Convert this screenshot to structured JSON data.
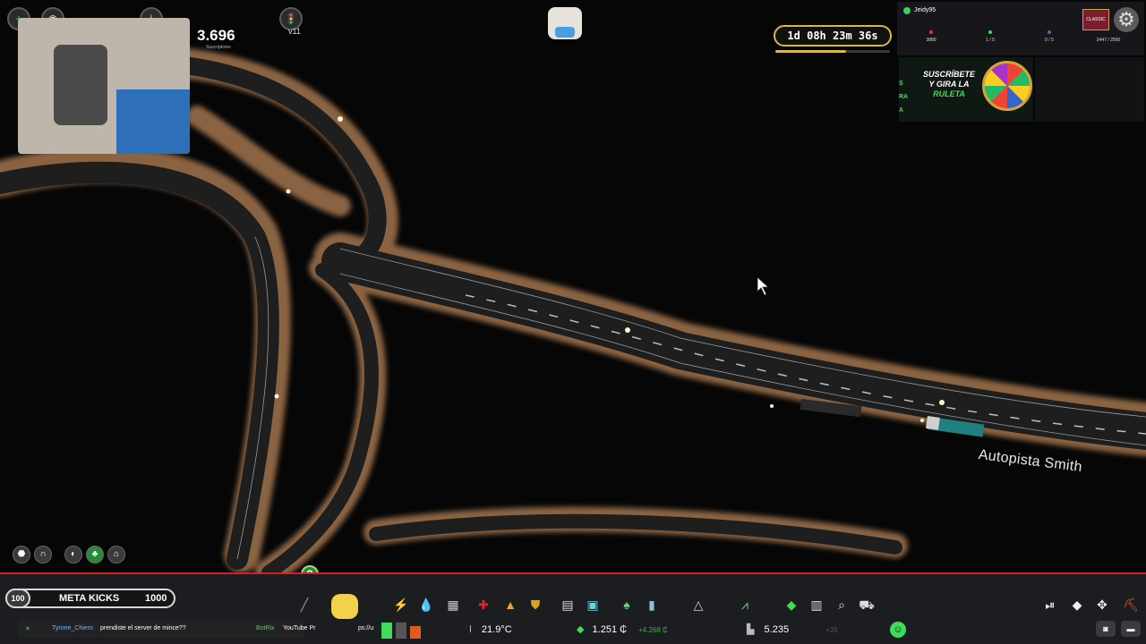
{
  "stream": {
    "subs_count": "3.696",
    "subs_label": "Suscriptores",
    "traffic_label": "v11",
    "timer": "1d 08h 23m 36s",
    "timer_progress": 0.62,
    "streamer": "Jeidy95",
    "stats": [
      "3880",
      "1 / 5",
      "0 / 5",
      "2447 / 2500"
    ],
    "classic_label": "CLASSIC",
    "ruleta_line1": "SUSCRÍBETE",
    "ruleta_line2": "Y GIRA LA",
    "ruleta_line3": "RULETA",
    "side_letters": [
      "S",
      "RA",
      "A"
    ]
  },
  "map": {
    "road_label": "Autopista Smith"
  },
  "icons": {
    "add": "plus-icon",
    "gear": "gear-icon",
    "help": "question-icon",
    "cursor": "mouse-cursor-icon"
  },
  "bottom": {
    "kicks_badge": "100",
    "kicks_title": "META KICKS",
    "kicks_max": "1000",
    "chat_user": "Tyrone_Chiero",
    "chat_msg": "prendiste el server de mince??",
    "chat_bot": "BotRix",
    "chat_promo": "YouTube Pr",
    "chat_extra": "ps://u",
    "temperature": "21.9°C",
    "money": "1.251 ₵",
    "money_delta": "+4.268 ₵",
    "population": "5.235",
    "population_delta": "+35",
    "toolbar_icons": [
      "road-icon",
      "mascot-icon",
      "electricity-icon",
      "water-icon",
      "fence-icon",
      "health-icon",
      "education-icon",
      "police-icon",
      "book-icon",
      "transport-icon",
      "park-icon",
      "landmark-icon",
      "triangle-icon",
      "terrain-icon",
      "money-icon",
      "clipboard-icon",
      "search-icon",
      "vehicle-icon"
    ],
    "right_icons": [
      "play-pause-icon",
      "eraser-icon",
      "move-icon",
      "bulldoze-icon"
    ]
  },
  "colors": {
    "accent_red": "#d42020",
    "accent_green": "#3fdc5a",
    "timer_gold": "#d9b84a"
  }
}
